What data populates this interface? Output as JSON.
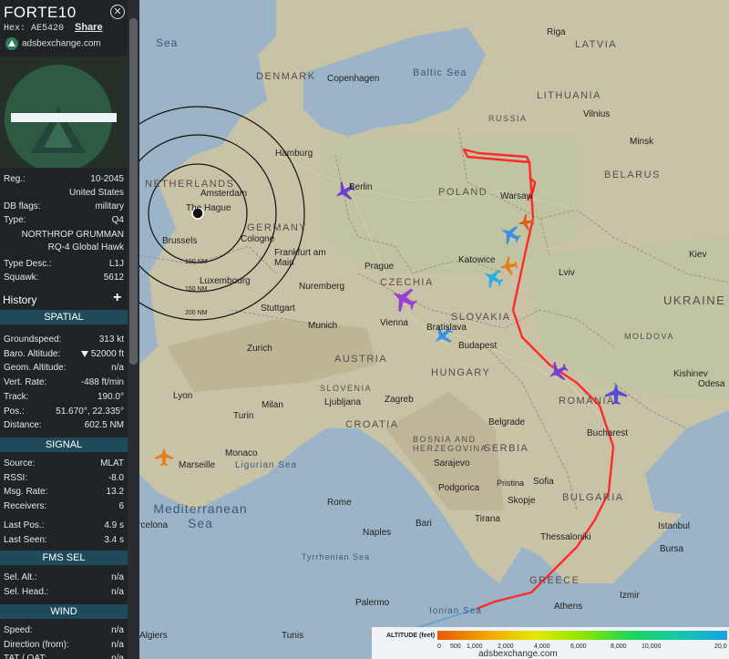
{
  "header": {
    "callsign": "FORTE10",
    "hex_label": "Hex:",
    "hex_value": "AE5420",
    "share_label": "Share",
    "brand": "adsbexchange.com"
  },
  "details": [
    {
      "key": "Reg.:",
      "value": "10-2045"
    },
    {
      "key": "",
      "value": "United States"
    },
    {
      "key": "DB flags:",
      "value": "military"
    },
    {
      "key": "Type:",
      "value": "Q4"
    }
  ],
  "type_name_line1": "NORTHROP GRUMMAN",
  "type_name_line2": "RQ-4 Global Hawk",
  "details2": [
    {
      "key": "Type Desc.:",
      "value": "L1J"
    },
    {
      "key": "Squawk:",
      "value": "5612"
    }
  ],
  "history_label": "History",
  "sections": {
    "spatial": "SPATIAL",
    "signal": "SIGNAL",
    "fms": "FMS SEL",
    "wind": "WIND"
  },
  "spatial": [
    {
      "key": "Groundspeed:",
      "value": "313 kt"
    },
    {
      "key": "Baro. Altitude:",
      "value": "52000 ft"
    },
    {
      "key": "Geom. Altitude:",
      "value": "n/a"
    },
    {
      "key": "Vert. Rate:",
      "value": "-488 ft/min"
    },
    {
      "key": "Track:",
      "value": "190.0°"
    },
    {
      "key": "Pos.:",
      "value": "51.670°, 22.335°"
    },
    {
      "key": "Distance:",
      "value": "602.5 NM"
    }
  ],
  "signal": [
    {
      "key": "Source:",
      "value": "MLAT"
    },
    {
      "key": "RSSI:",
      "value": "-8.0"
    },
    {
      "key": "Msg. Rate:",
      "value": "13.2"
    },
    {
      "key": "Receivers:",
      "value": "6"
    },
    {
      "key": "Last Pos.:",
      "value": "4.9 s"
    },
    {
      "key": "Last Seen:",
      "value": "3.4 s"
    }
  ],
  "fms": [
    {
      "key": "Sel. Alt.:",
      "value": "n/a"
    },
    {
      "key": "Sel. Head.:",
      "value": "n/a"
    }
  ],
  "wind": [
    {
      "key": "Speed:",
      "value": "n/a"
    },
    {
      "key": "Direction (from):",
      "value": "n/a"
    },
    {
      "key": "TAT / OAT:",
      "value": "n/a"
    }
  ],
  "map": {
    "range_rings": [
      "100 NM",
      "150 NM",
      "200 NM"
    ],
    "countries": [
      "DENMARK",
      "LATVIA",
      "LITHUANIA",
      "BELARUS",
      "POLAND",
      "NETHERLANDS",
      "GERMANY",
      "CZECHIA",
      "SLOVAKIA",
      "AUSTRIA",
      "HUNGARY",
      "UKRAINE",
      "ROMANIA",
      "SLOVENIA",
      "CROATIA",
      "BOSNIA AND HERZEGOVINA",
      "SERBIA",
      "BULGARIA",
      "GREECE",
      "RUSSIA",
      "MOLDOVA"
    ],
    "seas": [
      "Baltic Sea",
      "Ligurian Sea",
      "Mediterranean Sea",
      "Tyrrhenian Sea",
      "Ionian Sea",
      "Sea"
    ],
    "cities": [
      "Riga",
      "Copenhagen",
      "Vilnius",
      "Minsk",
      "Hamburg",
      "Berlin",
      "Amsterdam",
      "The Hague",
      "Brussels",
      "Cologne",
      "Warsaw",
      "Frankfurt am Main",
      "Luxembourg",
      "Prague",
      "Katowice",
      "Lviv",
      "Kiev",
      "Nuremberg",
      "Stuttgart",
      "Munich",
      "Vienna",
      "Bratislava",
      "Budapest",
      "Zurich",
      "Kishinev",
      "Odesa",
      "Lyon",
      "Milan",
      "Turin",
      "Ljubljana",
      "Zagreb",
      "Bucharest",
      "Belgrade",
      "Monaco",
      "Marseille",
      "Sarajevo",
      "Podgorica",
      "Pristina",
      "Sofia",
      "Skopje",
      "Rome",
      "Tirana",
      "Istanbul",
      "Bursa",
      "Naples",
      "Bari",
      "Thessaloniki",
      "Barcelona",
      "Palermo",
      "Tunis",
      "Algiers",
      "Athens",
      "Izmir"
    ],
    "legend_title": "ALTITUDE (feet)",
    "legend_ticks": [
      "0",
      "500",
      "1,000",
      "2,000",
      "4,000",
      "6,000",
      "8,000",
      "10,000",
      "20,0"
    ],
    "watermark": "adsbexchange.com"
  }
}
